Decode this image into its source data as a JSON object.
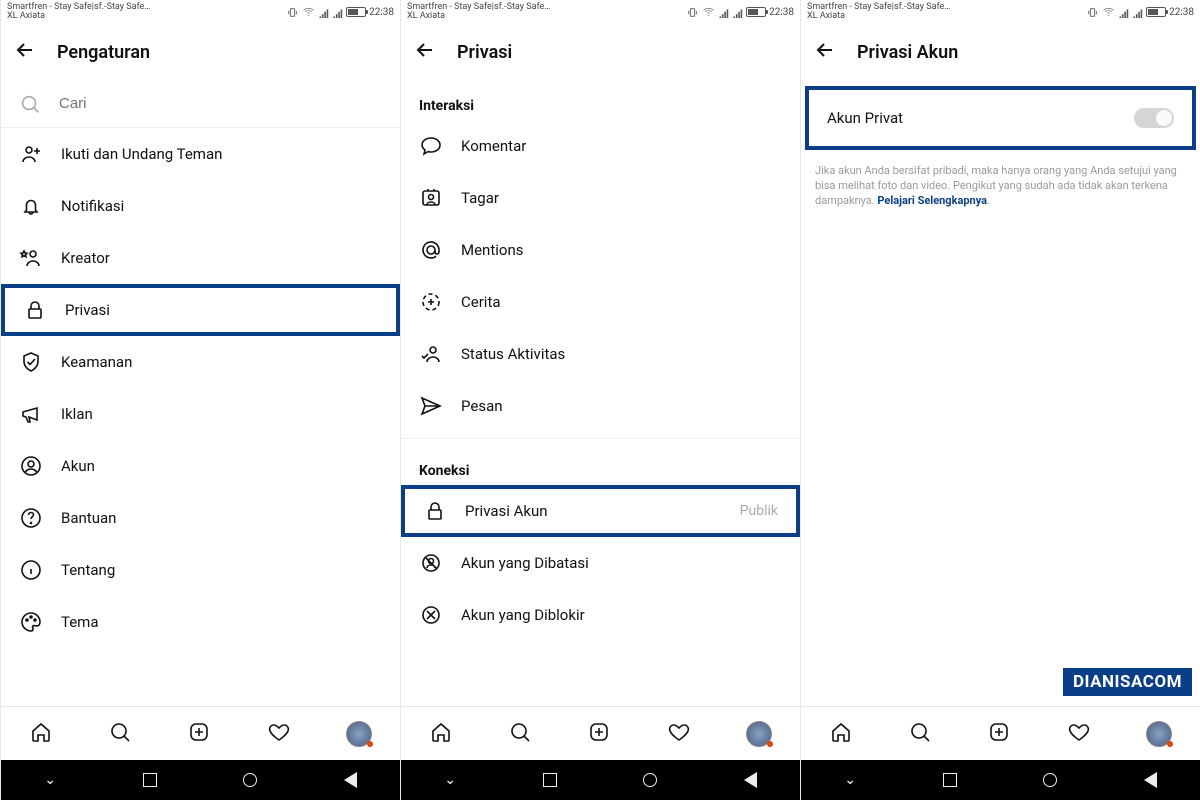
{
  "status": {
    "carrier_line1": "Smartfren - Stay Safe|sf.-Stay Safe…",
    "carrier_line2": "XL Axiata",
    "time": "22:38"
  },
  "watermark": "DIANISACOM",
  "screens": [
    {
      "header_title": "Pengaturan",
      "search_placeholder": "Cari",
      "items": [
        {
          "label": "Ikuti dan Undang Teman",
          "icon": "add-user-icon"
        },
        {
          "label": "Notifikasi",
          "icon": "bell-icon"
        },
        {
          "label": "Kreator",
          "icon": "star-user-icon"
        },
        {
          "label": "Privasi",
          "icon": "lock-icon"
        },
        {
          "label": "Keamanan",
          "icon": "shield-icon"
        },
        {
          "label": "Iklan",
          "icon": "megaphone-icon"
        },
        {
          "label": "Akun",
          "icon": "user-circle-icon"
        },
        {
          "label": "Bantuan",
          "icon": "help-icon"
        },
        {
          "label": "Tentang",
          "icon": "info-icon"
        },
        {
          "label": "Tema",
          "icon": "palette-icon"
        }
      ],
      "highlight_index": 3
    },
    {
      "header_title": "Privasi",
      "section1_title": "Interaksi",
      "section1_items": [
        {
          "label": "Komentar",
          "icon": "comment-icon"
        },
        {
          "label": "Tagar",
          "icon": "tag-user-icon"
        },
        {
          "label": "Mentions",
          "icon": "mention-icon"
        },
        {
          "label": "Cerita",
          "icon": "story-add-icon"
        },
        {
          "label": "Status Aktivitas",
          "icon": "activity-status-icon"
        },
        {
          "label": "Pesan",
          "icon": "send-icon"
        }
      ],
      "section2_title": "Koneksi",
      "section2_items": [
        {
          "label": "Privasi Akun",
          "icon": "lock-icon",
          "trailing": "Publik"
        },
        {
          "label": "Akun yang Dibatasi",
          "icon": "restrict-icon"
        },
        {
          "label": "Akun yang Diblokir",
          "icon": "block-icon"
        }
      ],
      "section2_highlight_index": 0
    },
    {
      "header_title": "Privasi Akun",
      "toggle_label": "Akun Privat",
      "toggle_on": false,
      "description": "Jika akun Anda bersifat pribadi, maka hanya orang yang Anda setujui yang bisa melihat foto dan video. Pengikut yang sudah ada tidak akan terkena dampaknya. ",
      "description_link": "Pelajari Selengkapnya"
    }
  ]
}
